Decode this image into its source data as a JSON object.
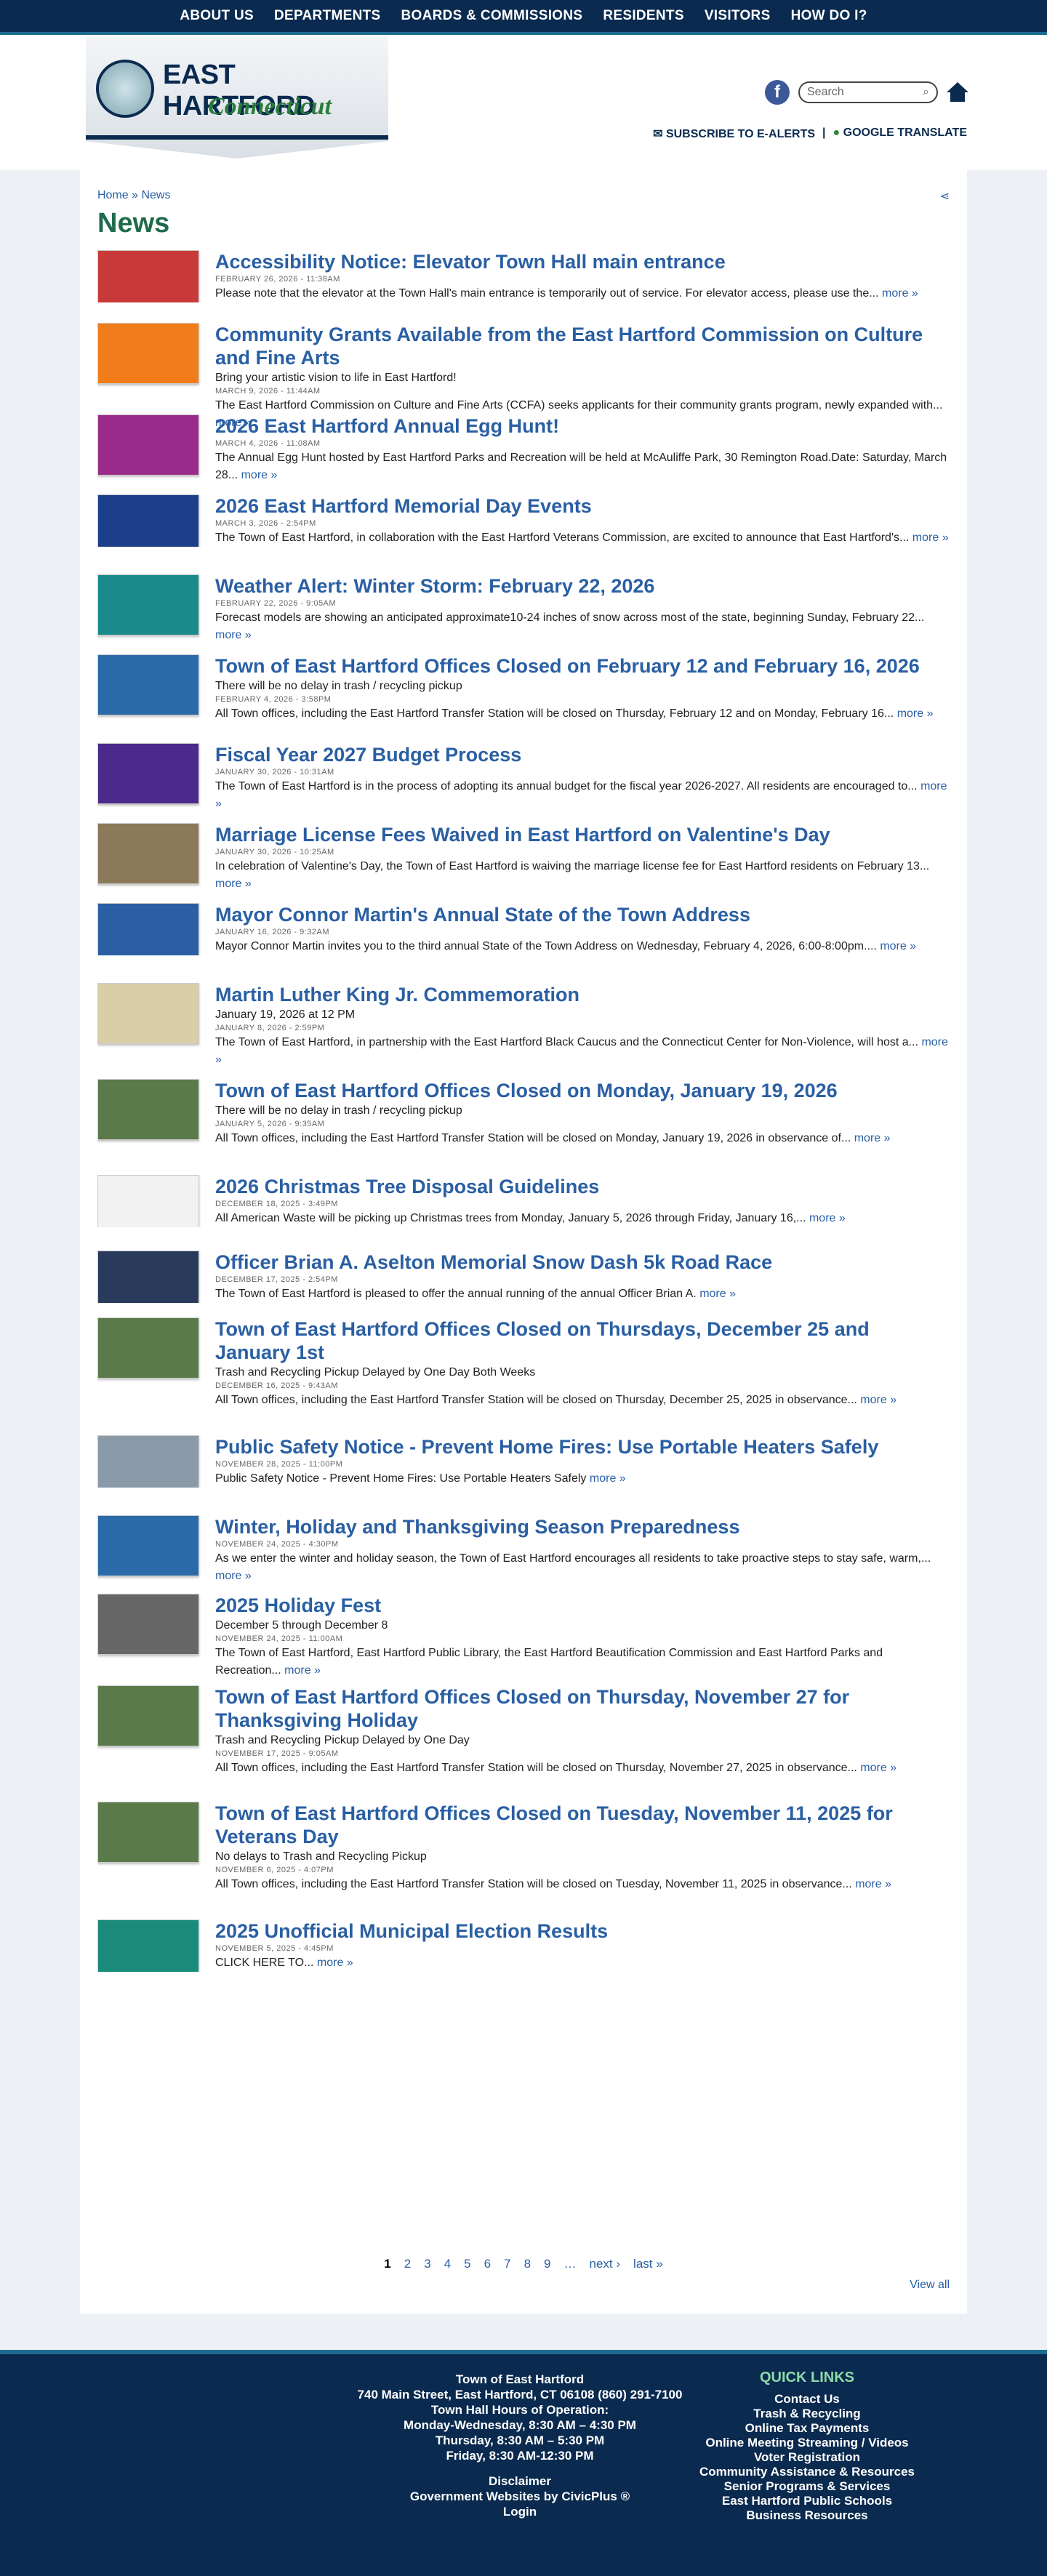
{
  "nav": [
    "ABOUT US",
    "DEPARTMENTS",
    "BOARDS & COMMISSIONS",
    "RESIDENTS",
    "VISITORS",
    "HOW DO I?"
  ],
  "logo": {
    "line1": "EAST HARTFORD",
    "line2": "Connecticut"
  },
  "search_placeholder": "Search",
  "subscribe": "SUBSCRIBE TO E-ALERTS",
  "translate": "GOOGLE TRANSLATE",
  "breadcrumb": "Home » News",
  "title": "News",
  "more": "more »",
  "items": [
    {
      "title": "Accessibility Notice: Elevator Town Hall main entrance",
      "sub": "",
      "date": "FEBRUARY 26, 2026 - 11:38AM",
      "desc": "Please note that  the elevator at the Town Hall's main entrance is temporarily out of service. For elevator access, please use the...",
      "thumb": "#c83a3a"
    },
    {
      "title": "Community Grants Available from the East Hartford Commission on Culture and Fine Arts",
      "sub": "Bring your artistic vision to life in East Hartford!",
      "date": "MARCH 9, 2026 - 11:44AM",
      "desc": "The East Hartford Commission on Culture and Fine Arts (CCFA) seeks applicants for their community grants program, newly expanded with...",
      "thumb": "#f07d1a"
    },
    {
      "title": "2026 East Hartford Annual Egg Hunt!",
      "sub": "",
      "date": "MARCH 4, 2026 - 11:08AM",
      "desc": "The Annual Egg Hunt hosted by East Hartford Parks and Recreation will be held at McAuliffe Park, 30 Remington Road.Date: Saturday, March 28...",
      "thumb": "#9a2b8a"
    },
    {
      "title": "2026 East Hartford Memorial Day Events",
      "sub": "",
      "date": "MARCH 3, 2026 - 2:54PM",
      "desc": "The Town of East Hartford, in collaboration with the East Hartford Veterans Commission, are excited to announce that East Hartford's...",
      "thumb": "#1d3f8a"
    },
    {
      "title": "Weather Alert: Winter Storm: February 22, 2026",
      "sub": "",
      "date": "FEBRUARY 22, 2026 - 9:05AM",
      "desc": "Forecast models are showing an anticipated approximate10-24 inches of snow across most of the state, beginning Sunday, February 22...",
      "thumb": "#1a8a8a"
    },
    {
      "title": "Town of East Hartford Offices Closed on February 12 and February 16, 2026",
      "sub": "There will be no delay in trash / recycling pickup",
      "date": "FEBRUARY 4, 2026 - 3:58PM",
      "desc": "All Town offices, including the East Hartford Transfer Station will be closed on Thursday, February 12 and on Monday, February 16...",
      "thumb": "#2a6aa8"
    },
    {
      "title": "Fiscal Year 2027 Budget Process",
      "sub": "",
      "date": "JANUARY 30, 2026 - 10:31AM",
      "desc": "The Town of East Hartford is in the process of adopting its annual budget for the fiscal year 2026-2027. All residents are encouraged to...",
      "thumb": "#4a2a8a"
    },
    {
      "title": "Marriage License Fees Waived in East Hartford on Valentine's Day",
      "sub": "",
      "date": "JANUARY 30, 2026 - 10:25AM",
      "desc": "In celebration of Valentine's Day, the Town of East Hartford is waiving the marriage license fee for East Hartford residents on February 13...",
      "thumb": "#8a7a5a"
    },
    {
      "title": "Mayor Connor Martin's Annual State of the Town Address",
      "sub": "",
      "date": "JANUARY 16, 2026 - 9:32AM",
      "desc": "Mayor Connor Martin invites you to the third annual State of the Town Address on Wednesday, February 4, 2026, 6:00-8:00pm....",
      "thumb": "#2a5fa3"
    },
    {
      "title": "Martin Luther King Jr. Commemoration",
      "sub": "January 19, 2026 at 12 PM",
      "date": "JANUARY 8, 2026 - 2:59PM",
      "desc": "The Town of East Hartford, in partnership with the East Hartford Black Caucus and the Connecticut Center for Non-Violence, will host a...",
      "thumb": "#d8cfa8"
    },
    {
      "title": "Town of East Hartford Offices Closed on Monday, January 19, 2026",
      "sub": "There will be no delay in trash / recycling pickup",
      "date": "JANUARY 5, 2026 - 9:35AM",
      "desc": "All Town offices, including the East Hartford Transfer Station will be closed on Monday, January 19, 2026 in observance of...",
      "thumb": "#5a7a4a"
    },
    {
      "title": "2026 Christmas Tree Disposal Guidelines",
      "sub": "",
      "date": "DECEMBER 18, 2025 - 3:49PM",
      "desc": "All American Waste will be picking up Christmas trees from Monday, January 5, 2026 through Friday, January 16,...",
      "thumb": "#f2f2f2"
    },
    {
      "title": "Officer Brian A. Aselton Memorial Snow Dash 5k Road Race",
      "sub": "",
      "date": "DECEMBER 17, 2025 - 2:54PM",
      "desc": "The Town of East Hartford is pleased to offer the annual running of the annual Officer Brian A.",
      "thumb": "#2a3a5a"
    },
    {
      "title": "Town of East Hartford Offices Closed on Thursdays, December 25 and January 1st",
      "sub": "Trash and Recycling Pickup Delayed by One Day Both Weeks",
      "date": "DECEMBER 16, 2025 - 9:43AM",
      "desc": "All Town offices, including the East Hartford Transfer Station will be closed on Thursday, December 25, 2025 in observance...",
      "thumb": "#5a7a4a"
    },
    {
      "title": "Public Safety Notice - Prevent Home Fires: Use Portable Heaters Safely",
      "sub": "",
      "date": "NOVEMBER 28, 2025 - 11:00PM",
      "desc": "Public Safety Notice - Prevent Home Fires: Use Portable Heaters Safely",
      "thumb": "#8a9aa8"
    },
    {
      "title": "Winter, Holiday and Thanksgiving Season Preparedness",
      "sub": "",
      "date": "NOVEMBER 24, 2025 - 4:30PM",
      "desc": "As we enter the winter and holiday season, the Town of East Hartford encourages all residents to take proactive steps to stay safe, warm,...",
      "thumb": "#2a6aa8"
    },
    {
      "title": "2025 Holiday Fest",
      "sub": "December 5 through December 8",
      "date": "NOVEMBER 24, 2025 - 11:00AM",
      "desc": "The Town of East Hartford, East Hartford Public Library, the East Hartford Beautification Commission and East Hartford Parks and Recreation...",
      "thumb": "#666666"
    },
    {
      "title": "Town of East Hartford Offices Closed on Thursday, November 27 for Thanksgiving Holiday",
      "sub": "Trash and Recycling Pickup Delayed by One Day",
      "date": "NOVEMBER 17, 2025 - 9:05AM",
      "desc": "All Town offices, including the East Hartford Transfer Station will be closed on Thursday, November 27, 2025 in observance...",
      "thumb": "#5a7a4a"
    },
    {
      "title": "Town of East Hartford Offices Closed on Tuesday, November 11, 2025 for Veterans Day",
      "sub": "No delays to Trash and Recycling Pickup",
      "date": "NOVEMBER 6, 2025 - 4:07PM",
      "desc": "All Town offices, including the East Hartford Transfer Station will be closed on Tuesday, November 11, 2025 in observance...",
      "thumb": "#5a7a4a"
    },
    {
      "title": "2025 Unofficial Municipal Election Results",
      "sub": "",
      "date": "NOVEMBER 5, 2025 - 4:45PM",
      "desc": "CLICK HERE TO...",
      "thumb": "#1a8a7a"
    }
  ],
  "pager": [
    "1",
    "2",
    "3",
    "4",
    "5",
    "6",
    "7",
    "8",
    "9",
    "…",
    "next ›",
    "last »"
  ],
  "view_all": "View all",
  "footer": {
    "lines": [
      "Town of East Hartford",
      "740 Main Street, East Hartford, CT 06108  (860) 291-7100",
      "Town Hall Hours of Operation:",
      "Monday-Wednesday, 8:30 AM – 4:30 PM",
      "Thursday, 8:30 AM – 5:30 PM",
      "Friday, 8:30 AM-12:30 PM",
      "",
      "Disclaimer",
      "Government Websites by CivicPlus ®",
      "Login"
    ],
    "quick_title": "QUICK LINKS",
    "quick": [
      "Contact Us",
      "Trash & Recycling",
      "Online Tax Payments",
      "Online Meeting Streaming / Videos",
      "Voter Registration",
      "Community Assistance & Resources",
      "Senior Programs & Services",
      "East Hartford Public Schools",
      "Business Resources"
    ]
  }
}
